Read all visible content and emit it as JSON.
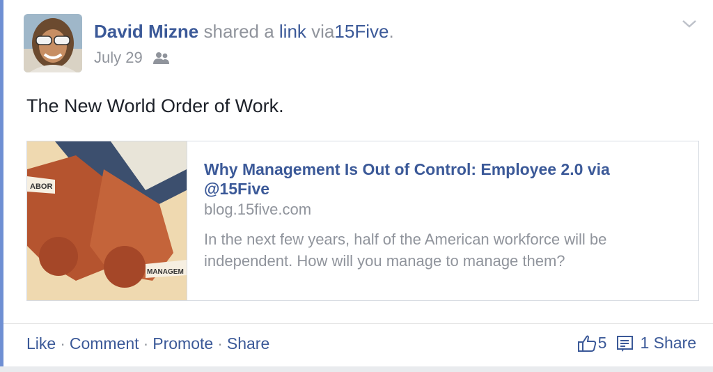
{
  "post": {
    "author": "David Mizne",
    "action_text_1": "shared a",
    "action_link": "link",
    "action_text_2": "via",
    "app_name": "15Five",
    "trailing": ".",
    "date": "July 29",
    "audience_icon": "friends-icon",
    "message": "The New World Order of Work."
  },
  "link_card": {
    "title": "Why Management Is Out of Control: Employee 2.0 via @15Five",
    "domain": "blog.15five.com",
    "description": "In the next few years, half of the American workforce will be independent. How will you manage to manage them?",
    "image_text_top": "ABOR",
    "image_text_bottom": "MANAGEM"
  },
  "actions": {
    "like": "Like",
    "comment": "Comment",
    "promote": "Promote",
    "share": "Share",
    "separator": "·"
  },
  "stats": {
    "likes": "5",
    "shares": "1 Share"
  },
  "colors": {
    "link_blue": "#3b5998",
    "muted_gray": "#90949c",
    "left_accent": "#6f8fd3"
  }
}
